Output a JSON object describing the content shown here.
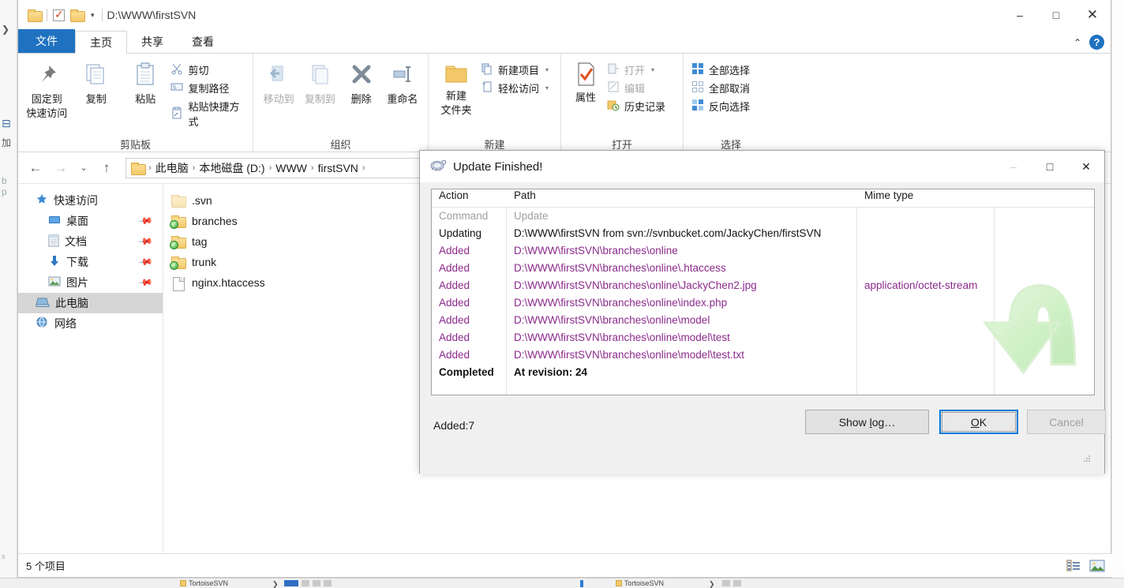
{
  "window": {
    "title_path": "D:\\WWW\\firstSVN",
    "minimize": "–",
    "maximize": "□",
    "close": "✕",
    "qat_icons": [
      "folder-icon",
      "properties-check-icon",
      "folder-icon",
      "customize-caret-icon"
    ]
  },
  "ribbon": {
    "tabs": [
      {
        "label": "文件",
        "name": "tab-file"
      },
      {
        "label": "主页",
        "name": "tab-home"
      },
      {
        "label": "共享",
        "name": "tab-share"
      },
      {
        "label": "查看",
        "name": "tab-view"
      }
    ],
    "collapse_icon": "⌃",
    "help_icon": "?",
    "groups": [
      {
        "label": "剪贴板",
        "big": [
          {
            "line1": "固定到",
            "line2": "快速访问",
            "icon": "pin-icon"
          },
          {
            "line1": "复制",
            "line2": "",
            "icon": "copy-icon"
          },
          {
            "line1": "粘贴",
            "line2": "",
            "icon": "paste-icon"
          }
        ],
        "small": [
          {
            "label": "剪切",
            "icon": "scissors-icon",
            "dim": false
          },
          {
            "label": "复制路径",
            "icon": "copy-path-icon",
            "dim": false
          },
          {
            "label": "粘贴快捷方式",
            "icon": "paste-shortcut-icon",
            "dim": false
          }
        ]
      },
      {
        "label": "组织",
        "big": [
          {
            "line1": "移动到",
            "line2": "",
            "icon": "move-to-icon"
          },
          {
            "line1": "复制到",
            "line2": "",
            "icon": "copy-to-icon"
          },
          {
            "line1": "删除",
            "line2": "",
            "icon": "delete-x-icon"
          },
          {
            "line1": "重命名",
            "line2": "",
            "icon": "rename-icon"
          }
        ],
        "small": []
      },
      {
        "label": "新建",
        "big": [
          {
            "line1": "新建",
            "line2": "文件夹",
            "icon": "new-folder-icon"
          }
        ],
        "small": [
          {
            "label": "新建项目",
            "icon": "new-item-icon",
            "caret": "▾"
          },
          {
            "label": "轻松访问",
            "icon": "easy-access-icon",
            "caret": "▾"
          }
        ]
      },
      {
        "label": "打开",
        "big": [
          {
            "line1": "属性",
            "line2": "",
            "icon": "properties-icon"
          }
        ],
        "small": [
          {
            "label": "打开",
            "icon": "open-icon",
            "caret": "▾",
            "dim": true
          },
          {
            "label": "编辑",
            "icon": "edit-icon",
            "dim": true
          },
          {
            "label": "历史记录",
            "icon": "history-icon",
            "dim": false
          }
        ]
      },
      {
        "label": "选择",
        "big": [],
        "small": [
          {
            "label": "全部选择",
            "icon": "select-all-icon"
          },
          {
            "label": "全部取消",
            "icon": "select-none-icon"
          },
          {
            "label": "反向选择",
            "icon": "invert-selection-icon"
          }
        ]
      }
    ]
  },
  "addressbar": {
    "back_icon": "←",
    "forward_icon": "→",
    "recent_icon": "⌄",
    "up_icon": "↑",
    "crumbs": [
      "此电脑",
      "本地磁盘 (D:)",
      "WWW",
      "firstSVN"
    ],
    "crumb_separator": "›",
    "trailing_separator": "›"
  },
  "navpane": {
    "items": [
      {
        "label": "快速访问",
        "icon": "star-pin-icon",
        "child": false,
        "pinned": false,
        "selected": false
      },
      {
        "label": "桌面",
        "icon": "desktop-icon",
        "child": true,
        "pinned": true,
        "selected": false
      },
      {
        "label": "文档",
        "icon": "documents-icon",
        "child": true,
        "pinned": true,
        "selected": false
      },
      {
        "label": "下载",
        "icon": "downloads-icon",
        "child": true,
        "pinned": true,
        "selected": false
      },
      {
        "label": "图片",
        "icon": "pictures-icon",
        "child": true,
        "pinned": true,
        "selected": false
      },
      {
        "label": "此电脑",
        "icon": "this-pc-icon",
        "child": false,
        "pinned": false,
        "selected": true
      },
      {
        "label": "网络",
        "icon": "network-icon",
        "child": false,
        "pinned": false,
        "selected": false
      }
    ]
  },
  "filelist": {
    "items": [
      {
        "name": ".svn",
        "type": "folder",
        "faded": true,
        "svn": false
      },
      {
        "name": "branches",
        "type": "folder",
        "faded": false,
        "svn": true
      },
      {
        "name": "tag",
        "type": "folder",
        "faded": false,
        "svn": true
      },
      {
        "name": "trunk",
        "type": "folder",
        "faded": false,
        "svn": true
      },
      {
        "name": "nginx.htaccess",
        "type": "file",
        "faded": false,
        "svn": false
      }
    ]
  },
  "statusbar": {
    "item_count": "5 个项目",
    "view_details_icon": "details-view-icon",
    "view_thumbnails_icon": "large-icons-view-icon"
  },
  "dialog": {
    "title": "Update Finished!",
    "title_icon": "tortoisesvn-turtle-icon",
    "minimize": "–",
    "maximize": "□",
    "close": "✕",
    "columns": [
      "Action",
      "Path",
      "Mime type"
    ],
    "rows": [
      {
        "action": "Command",
        "path": "Update",
        "mime": "",
        "style": "grey"
      },
      {
        "action": "Updating",
        "path": "D:\\WWW\\firstSVN from svn://svnbucket.com/JackyChen/firstSVN",
        "mime": "",
        "style": "black"
      },
      {
        "action": "Added",
        "path": "D:\\WWW\\firstSVN\\branches\\online",
        "mime": "",
        "style": "added"
      },
      {
        "action": "Added",
        "path": "D:\\WWW\\firstSVN\\branches\\online\\.htaccess",
        "mime": "",
        "style": "added"
      },
      {
        "action": "Added",
        "path": "D:\\WWW\\firstSVN\\branches\\online\\JackyChen2.jpg",
        "mime": "application/octet-stream",
        "style": "added"
      },
      {
        "action": "Added",
        "path": "D:\\WWW\\firstSVN\\branches\\online\\index.php",
        "mime": "",
        "style": "added"
      },
      {
        "action": "Added",
        "path": "D:\\WWW\\firstSVN\\branches\\online\\model",
        "mime": "",
        "style": "added"
      },
      {
        "action": "Added",
        "path": "D:\\WWW\\firstSVN\\branches\\online\\model\\test",
        "mime": "",
        "style": "added"
      },
      {
        "action": "Added",
        "path": "D:\\WWW\\firstSVN\\branches\\online\\model\\test.txt",
        "mime": "",
        "style": "added"
      },
      {
        "action": "Completed",
        "path": "At revision: 24",
        "mime": "",
        "style": "bold"
      }
    ],
    "summary": "Added:7",
    "buttons": {
      "show_log": "Show log…",
      "ok": "OK",
      "cancel": "Cancel"
    },
    "watermark_icon": "green-update-arrow-icon"
  },
  "taskbar": {
    "items": [
      {
        "label": "TortoiseSVN",
        "icon": "folder-icon"
      },
      {
        "label": "TortoiseSVN",
        "icon": "folder-icon"
      }
    ]
  },
  "colors": {
    "accent": "#1f72c0",
    "added_text": "#8b2a8b",
    "focus_border": "#0078d7",
    "selection_grey": "#d6d6d6"
  }
}
